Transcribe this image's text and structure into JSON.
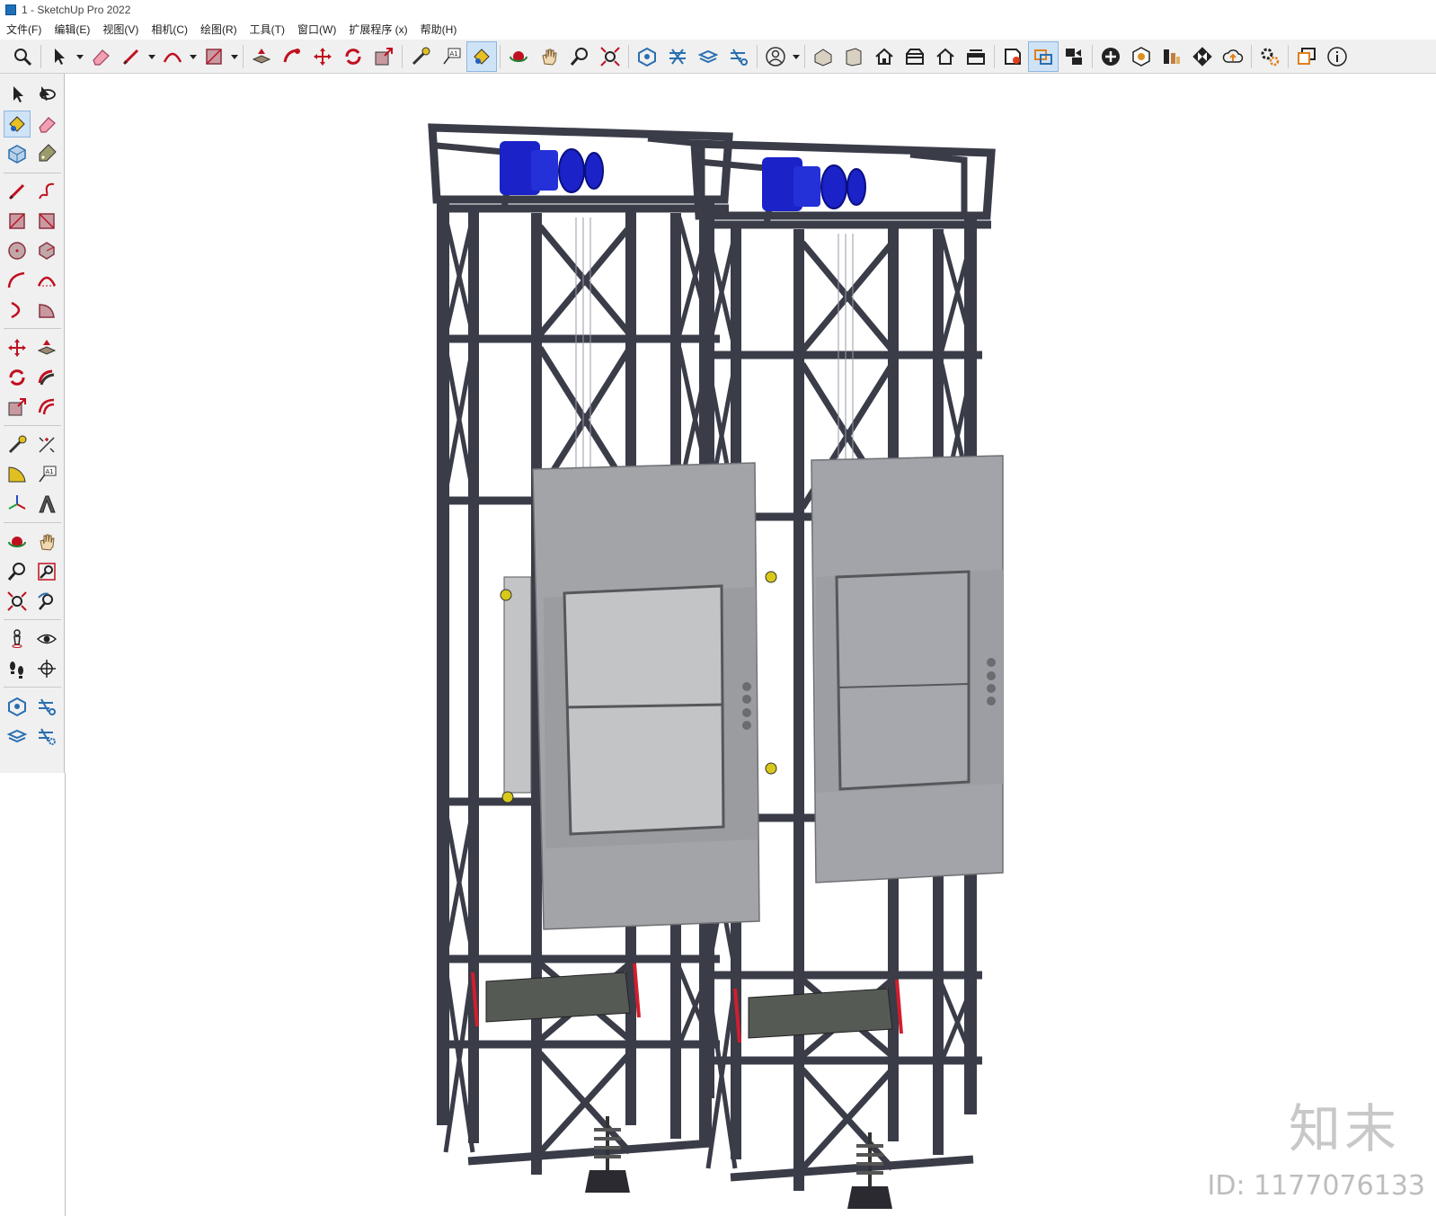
{
  "window": {
    "title": "1 - SketchUp Pro 2022"
  },
  "menu": [
    "文件(F)",
    "编辑(E)",
    "视图(V)",
    "相机(C)",
    "绘图(R)",
    "工具(T)",
    "窗口(W)",
    "扩展程序 (x)",
    "帮助(H)"
  ],
  "watermark": {
    "brand": "知末",
    "id": "ID: 1177076133"
  },
  "colors": {
    "frame": "#3a3c48",
    "door": "#9fa1a5",
    "motor": "#1a22c8",
    "accent_red": "#d01e2e"
  }
}
